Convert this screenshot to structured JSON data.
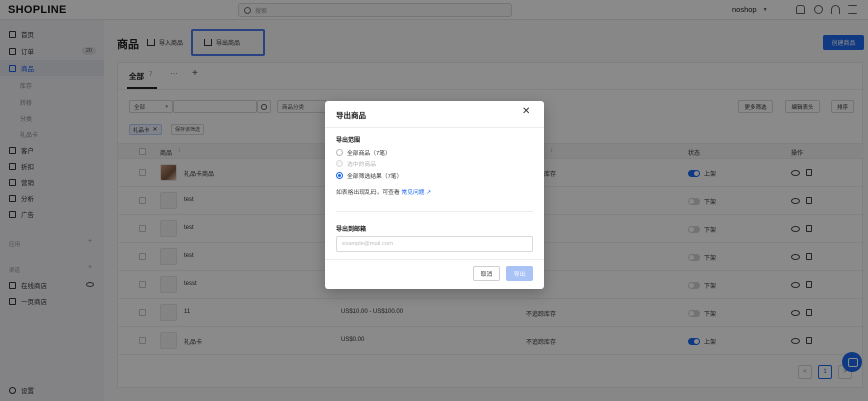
{
  "topbar": {
    "logo": "SHOPLINE",
    "search_placeholder": "搜索",
    "store_name": "noshop"
  },
  "sidebar": {
    "items": [
      {
        "label": "首页",
        "icon": "home-icon"
      },
      {
        "label": "订单",
        "icon": "order-icon",
        "badge": "20"
      },
      {
        "label": "商品",
        "icon": "product-icon"
      },
      {
        "label": "库存"
      },
      {
        "label": "转移"
      },
      {
        "label": "分类"
      },
      {
        "label": "礼品卡"
      },
      {
        "label": "客户",
        "icon": "customer-icon"
      },
      {
        "label": "折扣",
        "icon": "discount-icon"
      },
      {
        "label": "营销",
        "icon": "marketing-icon"
      },
      {
        "label": "分析",
        "icon": "analytics-icon"
      },
      {
        "label": "广告",
        "icon": "ads-icon"
      }
    ],
    "section_apps": "应用",
    "section_channels": "渠道",
    "channel_items": [
      {
        "label": "在线商店",
        "icon": "store-icon"
      },
      {
        "label": "一页商店",
        "icon": "onepage-icon"
      }
    ],
    "settings": "设置"
  },
  "page": {
    "title": "商品",
    "import_label": "导入商品",
    "export_label": "导出商品",
    "create_label": "创建商品"
  },
  "tabs": {
    "all_label": "全部",
    "all_count": "7",
    "more": "···",
    "add": "+"
  },
  "filters": {
    "all_select": "全部",
    "category_select": "商品分类",
    "more_filters": "更多筛选",
    "edit_columns": "编辑表头",
    "sort": "排序",
    "active_chip": "礼品卡",
    "save_filter": "保存该筛选"
  },
  "table": {
    "headers": {
      "product": "商品",
      "product_sort": "↕",
      "inventory": "↕",
      "status": "状态",
      "actions": "操作"
    },
    "rows": [
      {
        "name": "礼品卡商品",
        "price": "",
        "stock": "不追踪库存",
        "status": "上架",
        "on": true,
        "image": true
      },
      {
        "name": "test",
        "price": "",
        "stock": "",
        "status": "下架",
        "on": false,
        "image": false
      },
      {
        "name": "test",
        "price": "",
        "stock": "",
        "status": "下架",
        "on": false,
        "image": false
      },
      {
        "name": "test",
        "price": "",
        "stock": "",
        "status": "下架",
        "on": false,
        "image": false
      },
      {
        "name": "tesst",
        "price": "",
        "stock": "",
        "status": "下架",
        "on": false,
        "image": false
      },
      {
        "name": "11",
        "price": "US$10.00 - US$100.00",
        "stock": "不追踪库存",
        "status": "下架",
        "on": false,
        "image": false
      },
      {
        "name": "礼品卡",
        "price": "US$0.00",
        "stock": "不追踪库存",
        "status": "上架",
        "on": true,
        "image": false
      }
    ]
  },
  "pagination": {
    "prev": "<",
    "current": "1",
    "next": ">"
  },
  "modal": {
    "title": "导出商品",
    "close": "✕",
    "range_label": "导出范围",
    "options": [
      {
        "label": "全部商品（7笔）",
        "checked": false,
        "disabled": false
      },
      {
        "label": "选中的商品",
        "checked": false,
        "disabled": true
      },
      {
        "label": "全部筛选结果（7笔）",
        "checked": true,
        "disabled": false
      }
    ],
    "note_prefix": "如表格出现乱码，可查看",
    "note_link": "常见问题",
    "email_label": "导出到邮箱",
    "email_placeholder": "example@mail.com",
    "cancel": "取消",
    "export": "导出"
  },
  "colors": {
    "accent": "#1d6af0",
    "highlight_border": "#4d7cf0"
  }
}
